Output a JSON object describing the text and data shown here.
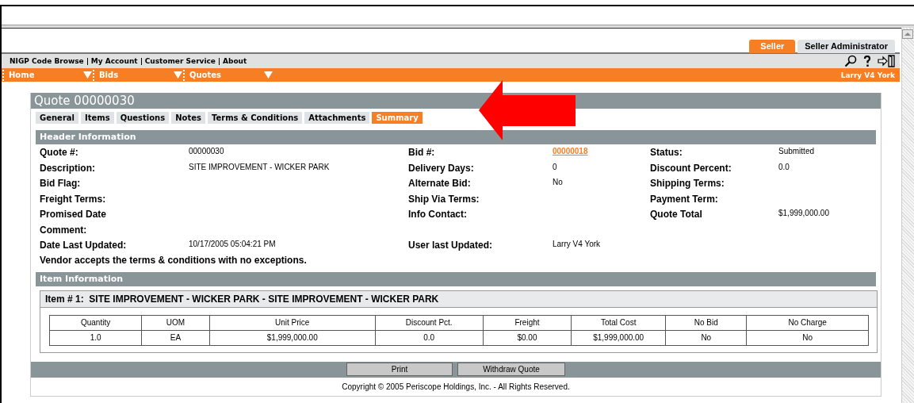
{
  "roles": [
    {
      "label": "Seller",
      "selected": true
    },
    {
      "label": "Seller Administrator",
      "selected": false
    }
  ],
  "links": [
    "NIGP Code Browse",
    "My Account",
    "Customer Service",
    "About"
  ],
  "nav": [
    "Home",
    "Bids",
    "Quotes"
  ],
  "user": "Larry V4 York",
  "title": "Quote 00000030",
  "tabs": [
    {
      "label": "General",
      "selected": false
    },
    {
      "label": "Items",
      "selected": false
    },
    {
      "label": "Questions",
      "selected": false
    },
    {
      "label": "Notes",
      "selected": false
    },
    {
      "label": "Terms & Conditions",
      "selected": false
    },
    {
      "label": "Attachments",
      "selected": false
    },
    {
      "label": "Summary",
      "selected": true
    }
  ],
  "header_title": "Header Information",
  "header_rows": [
    [
      {
        "label": "Quote #:",
        "value": "00000030",
        "kind": "text"
      },
      {
        "label": "Bid #:",
        "value": "00000018",
        "kind": "link"
      },
      {
        "label": "Status:",
        "value": "Submitted",
        "kind": "text"
      }
    ],
    [
      {
        "label": "Description:",
        "value": "SITE IMPROVEMENT - WICKER PARK",
        "kind": "text"
      },
      {
        "label": "Delivery Days:",
        "value": "0",
        "kind": "text"
      },
      {
        "label": "Discount Percent:",
        "value": "0.0",
        "kind": "text"
      }
    ],
    [
      {
        "label": "Bid Flag:"
      },
      {
        "label": "Alternate Bid:",
        "value": "No",
        "kind": "text"
      },
      {
        "label": "Shipping Terms:"
      }
    ],
    [
      {
        "label": "Freight Terms:"
      },
      {
        "label": "Ship Via Terms:"
      },
      {
        "label": "Payment Term:"
      }
    ],
    [
      {
        "label": "Promised Date"
      },
      {
        "label": "Info Contact:"
      },
      {
        "label": "Quote Total",
        "value": "$1,999,000.00",
        "kind": "text"
      }
    ],
    [
      {
        "label": "Comment:"
      }
    ],
    [
      {
        "label": "Date Last Updated:",
        "value": "10/17/2005 05:04:21 PM",
        "kind": "text"
      },
      {
        "label": "User last Updated:",
        "value": "Larry V4 York",
        "kind": "text"
      }
    ]
  ],
  "terms_note": "Vendor accepts the terms & conditions with no exceptions.",
  "item_title": "Item Information",
  "item_heading": "Item # 1:  SITE IMPROVEMENT - WICKER PARK - SITE IMPROVEMENT - WICKER PARK",
  "item_table": {
    "columns": [
      "Quantity",
      "UOM",
      "Unit Price",
      "Discount Pct.",
      "Freight",
      "Total Cost",
      "No Bid",
      "No Charge"
    ],
    "rows": [
      [
        "1.0",
        "EA",
        "$1,999,000.00",
        "0.0",
        "$0.00",
        "$1,999,000.00",
        "No",
        "No"
      ]
    ]
  },
  "buttons": [
    "Print",
    "Withdraw Quote"
  ],
  "copyright": "Copyright © 2005 Periscope Holdings, Inc. - All Rights Reserved."
}
